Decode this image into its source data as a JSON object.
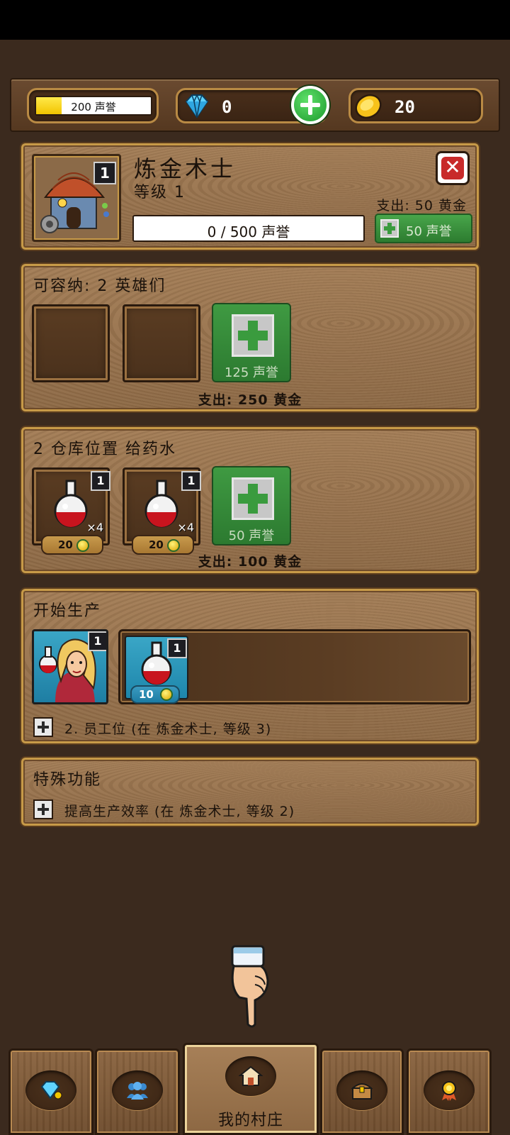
{
  "resources": {
    "reputation_label": "200 声誉",
    "reputation_fill": 0.4,
    "gems": "0",
    "gold": "20"
  },
  "building": {
    "name": "炼金术士",
    "level_label": "等级 1",
    "level_badge": "1",
    "upgrade_cost": "支出: 50 黄金",
    "progress": "0 / 500 声誉",
    "upgrade_button": "50 声誉"
  },
  "heroes": {
    "title": "可容纳: 2 英雄们",
    "add_slot_label": "125 声誉",
    "cost": "支出: 250 黄金"
  },
  "storage": {
    "title": "2 仓库位置 给药水",
    "items": [
      {
        "badge": "1",
        "qty": "×4",
        "price": "20"
      },
      {
        "badge": "1",
        "qty": "×4",
        "price": "20"
      }
    ],
    "add_slot_label": "50 声誉",
    "cost": "支出: 100 黄金"
  },
  "production": {
    "title": "开始生产",
    "worker_badge": "1",
    "queue_item": {
      "badge": "1",
      "price": "10"
    },
    "worker_slot": "2. 员工位 (在 炼金术士, 等级 3)"
  },
  "special": {
    "title": "特殊功能",
    "item": "提高生产效率 (在 炼金术士, 等级 2)"
  },
  "nav": {
    "active_label": "我的村庄",
    "items": [
      "gem-shop",
      "heroes",
      "my-village",
      "treasure-chest",
      "achievements"
    ]
  },
  "colors": {
    "panel_border": "#c79a48",
    "wood_background": "#3b2a1e",
    "green_button": "#3f9a42",
    "close_red": "#c82a2a"
  }
}
